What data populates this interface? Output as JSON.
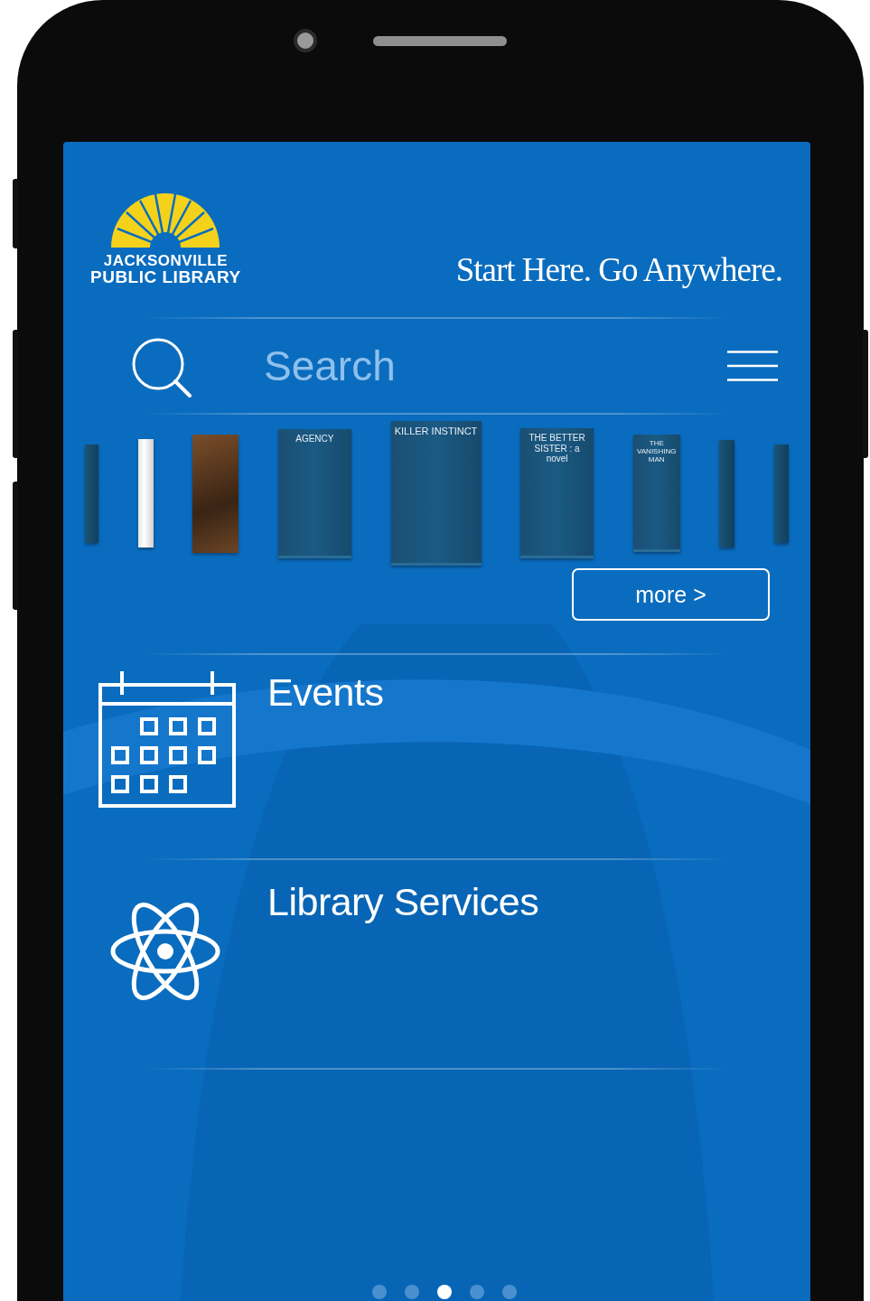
{
  "header": {
    "logo_line1": "JACKSONVILLE",
    "logo_line2": "PUBLIC LIBRARY",
    "tagline": "Start Here. Go Anywhere."
  },
  "search": {
    "placeholder": "Search"
  },
  "carousel": {
    "covers": [
      {
        "kind": "spine"
      },
      {
        "kind": "white"
      },
      {
        "kind": "photo"
      },
      {
        "kind": "plain",
        "title": "AGENCY"
      },
      {
        "kind": "plain",
        "title": "KILLER INSTINCT"
      },
      {
        "kind": "plain",
        "title": "THE BETTER SISTER : a novel"
      },
      {
        "kind": "plain",
        "title": "THE VANISHING MAN"
      },
      {
        "kind": "spine"
      },
      {
        "kind": "spine"
      }
    ],
    "more_button": "more >"
  },
  "menu_items": [
    {
      "kind": "events",
      "label": "Events"
    },
    {
      "kind": "services",
      "label": "Library Services"
    }
  ],
  "page_dots": [
    {
      "selected": false
    },
    {
      "selected": false
    },
    {
      "selected": true
    },
    {
      "selected": false
    },
    {
      "selected": false
    }
  ]
}
